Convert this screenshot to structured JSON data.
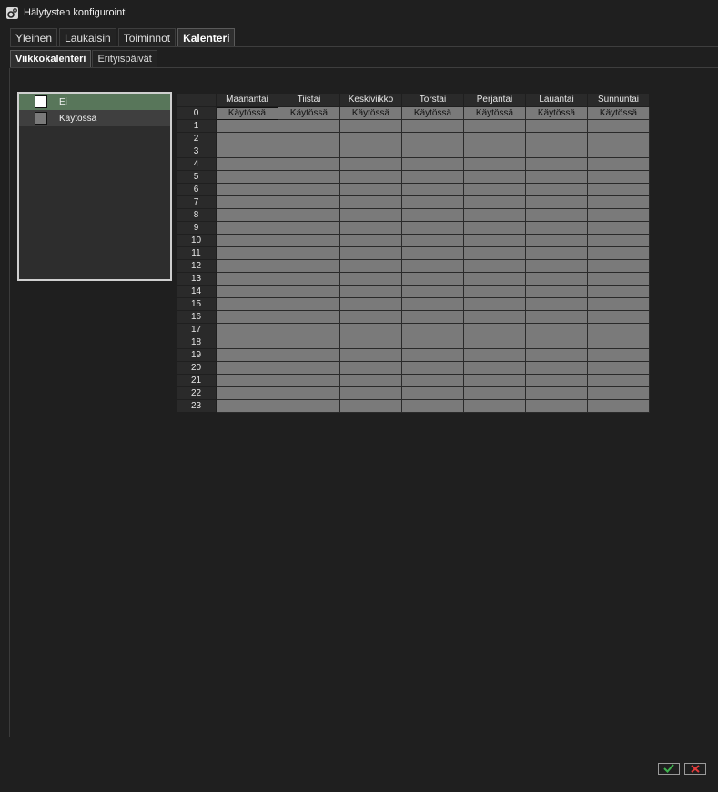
{
  "window": {
    "title": "Hälytysten konfigurointi"
  },
  "tabs": [
    "Yleinen",
    "Laukaisin",
    "Toiminnot",
    "Kalenteri"
  ],
  "subtabs": [
    "Viikkokalenteri",
    "Erityispäivät"
  ],
  "legend": [
    {
      "label": "Ei",
      "color": "#ffffff"
    },
    {
      "label": "Käytössä",
      "color": "#7a7a7a"
    }
  ],
  "calendar": {
    "days": [
      "Maanantai",
      "Tiistai",
      "Keskiviikko",
      "Torstai",
      "Perjantai",
      "Lauantai",
      "Sunnuntai"
    ],
    "hours": [
      "0",
      "1",
      "2",
      "3",
      "4",
      "5",
      "6",
      "7",
      "8",
      "9",
      "10",
      "11",
      "12",
      "13",
      "14",
      "15",
      "16",
      "17",
      "18",
      "19",
      "20",
      "21",
      "22",
      "23"
    ],
    "row0_label": "Käytössä"
  },
  "buttons": {
    "ok_icon": "check-icon",
    "cancel_icon": "close-icon"
  },
  "colors": {
    "accent_ok": "#3fb34f",
    "accent_cancel": "#e33b3b",
    "selected_legend": "#58765a",
    "enabled_cell": "#7a7a7a"
  }
}
